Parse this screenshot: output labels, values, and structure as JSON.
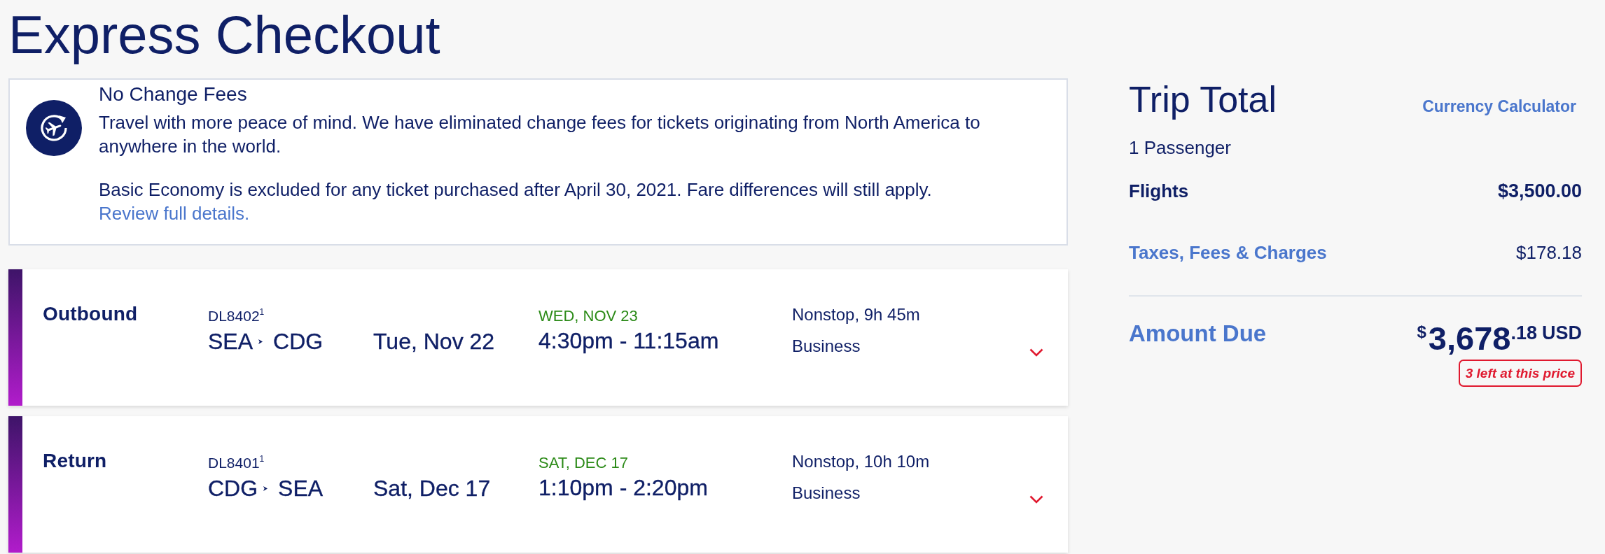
{
  "page": {
    "title": "Express Checkout"
  },
  "notice": {
    "title": "No Change Fees",
    "paragraphs": [
      {
        "text": "Travel with more peace of mind. We have eliminated change fees for tickets originating from North America to anywhere in the world."
      },
      {
        "text": "Basic Economy is excluded for any ticket purchased after April 30, 2021. Fare differences will still apply.",
        "link": "Review full details."
      }
    ]
  },
  "flights": [
    {
      "direction": "Outbound",
      "flight_number": "DL8402$^{1}$",
      "origin": "SEA",
      "destination": "CDG",
      "date": "Tue, Nov 22",
      "date_label": "WED, NOV 23",
      "times": "4:30pm - 11:15am",
      "stops": "Nonstop, 9h 45m",
      "cabin": "Business",
      "expanded": false
    },
    {
      "direction": "Return",
      "flight_number": "DL8401$^{1}$",
      "origin": "CDG",
      "destination": "SEA",
      "date": "Sat, Dec 17",
      "date_label": "SAT, DEC 17",
      "times": "1:10pm - 2:20pm",
      "stops": "Nonstop, 10h 10m",
      "cabin": "Business",
      "expanded": false
    }
  ],
  "trip_total": {
    "title": "Trip Total",
    "link": "Currency Calculator",
    "passengers": "1 Passenger",
    "lines": [
      {
        "kind": "plain",
        "label": "Flights",
        "amount": "$3,500.00"
      },
      {
        "kind": "link",
        "label": "Taxes, Fees & Charges",
        "amount": "$178.18"
      }
    ],
    "amount_due": {
      "label": "Amount Due",
      "symbol": "$",
      "whole": "3,678",
      "cents": ".18",
      "currency": "USD"
    },
    "badge": "3 left at this price"
  }
}
